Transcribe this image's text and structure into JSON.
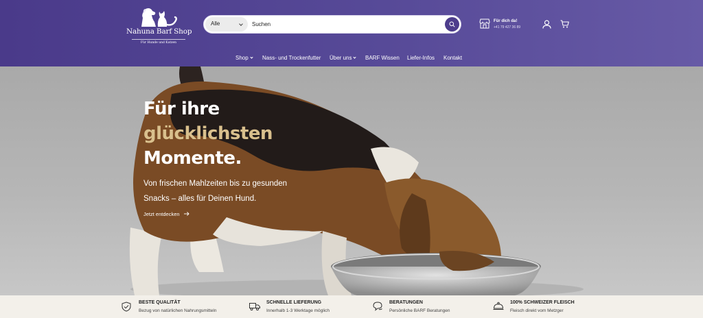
{
  "header": {
    "logo_name": "Nahuna Barf Shop",
    "logo_tagline": "Für Hunde und Katzen",
    "search": {
      "category": "Alle",
      "placeholder": "Suchen"
    },
    "contact": {
      "title": "Für dich da!",
      "phone": "+41 79 427 36 89"
    },
    "colors": {
      "brand": "#4a3a8a"
    }
  },
  "nav": {
    "items": [
      {
        "label": "Shop",
        "dropdown": true
      },
      {
        "label": "Nass- und Trockenfutter",
        "dropdown": false
      },
      {
        "label": "Über uns",
        "dropdown": true
      },
      {
        "label": "BARF Wissen",
        "dropdown": false
      },
      {
        "label": "Liefer-Infos",
        "dropdown": false
      },
      {
        "label": "Kontakt",
        "dropdown": false
      }
    ]
  },
  "hero": {
    "title_line1": "Für ihre",
    "title_line2": "glücklichsten",
    "title_line3": "Momente.",
    "subtitle": "Von frischen Mahlzeiten bis zu gesunden Snacks – alles für Deinen Hund.",
    "link": "Jetzt entdecken",
    "colors": {
      "accent": "#d9c08d"
    }
  },
  "features": [
    {
      "icon": "shield-check-icon",
      "title": "BESTE QUALITÄT",
      "desc": "Bezug von natürlichen Nahrungsmitteln"
    },
    {
      "icon": "truck-icon",
      "title": "SCHNELLE LIEFERUNG",
      "desc": "Innerhalb 1-3 Werktage möglich"
    },
    {
      "icon": "chat-bubbles-icon",
      "title": "BERATUNGEN",
      "desc": "Persönliche BARF Beratungen"
    },
    {
      "icon": "cloche-icon",
      "title": "100% SCHWEIZER FLEISCH",
      "desc": "Fleisch direkt vom Metzger"
    }
  ]
}
